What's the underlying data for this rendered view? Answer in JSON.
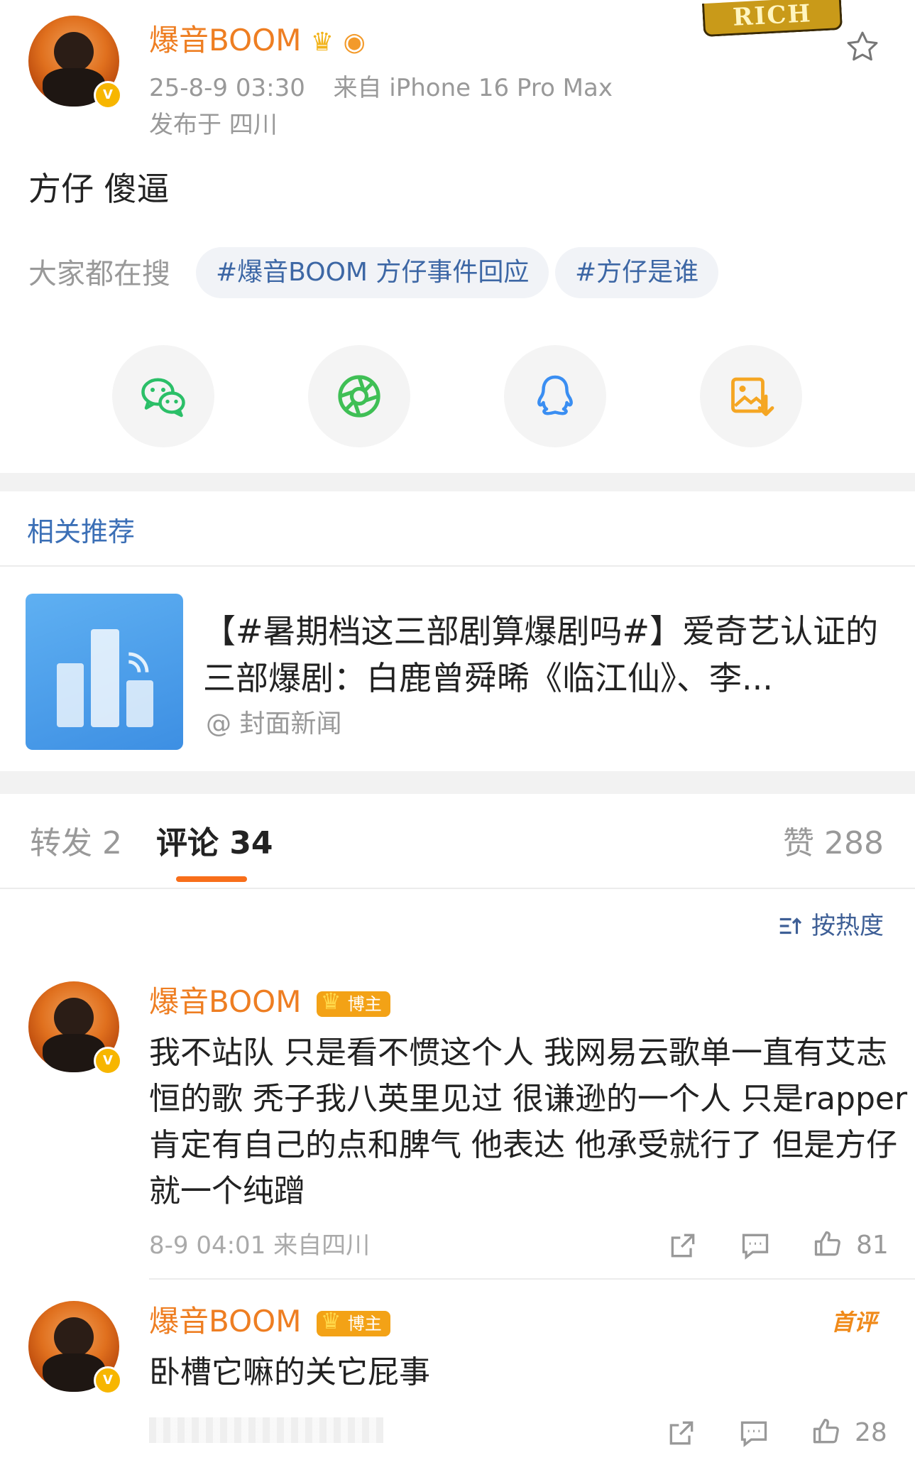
{
  "post": {
    "author": "爆音BOOM",
    "timestamp": "25-8-9 03:30",
    "device": "来自 iPhone 16 Pro Max",
    "location": "发布于 四川",
    "text": "方仔 傻逼"
  },
  "trending": {
    "label": "大家都在搜",
    "chips": [
      "#爆音BOOM 方仔事件回应",
      "#方仔是谁"
    ]
  },
  "share": {
    "icons": [
      "wechat-icon",
      "moments-icon",
      "qq-icon",
      "save-image-icon"
    ],
    "colors": {
      "wechat": "#2bbf68",
      "moments": "#3fbf55",
      "qq": "#3a8ef2",
      "save": "#f5a623"
    }
  },
  "related": {
    "section_title": "相关推荐",
    "title": "【#暑期档这三部剧算爆剧吗#】爱奇艺认证的三部爆剧：白鹿曾舜晞《临江仙》、李...",
    "source": "@ 封面新闻"
  },
  "tabs": {
    "repost": "转发 2",
    "comments": "评论 34",
    "likes": "赞 288"
  },
  "sort": {
    "label": "按热度"
  },
  "comments": [
    {
      "author": "爆音BOOM",
      "badge": "博主",
      "text": "我不站队 只是看不惯这个人 我网易云歌单一直有艾志恒的歌 秃子我八英里见过 很谦逊的一个人 只是rapper肯定有自己的点和脾气 他表达 他承受就行了 但是方仔 就一个纯蹭",
      "time": "8-9 04:01",
      "source": "来自四川",
      "likes": "81"
    },
    {
      "author": "爆音BOOM",
      "badge": "博主",
      "tag": "首评",
      "text": "卧槽它嘛的关它屁事",
      "likes": "28"
    }
  ],
  "colors": {
    "accent_orange": "#ee7e22",
    "link_blue": "#3d67a5",
    "tab_underline": "#f86e1a"
  }
}
